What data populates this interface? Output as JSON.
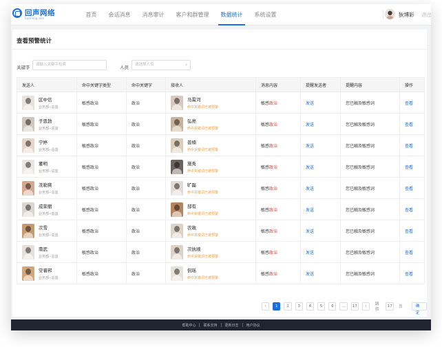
{
  "header": {
    "logo_title": "回声网络",
    "logo_subtitle": "huisheng.com",
    "nav": [
      "首页",
      "会话消息",
      "消息审计",
      "客户和群管理",
      "数据统计",
      "系统设置"
    ],
    "active_nav": 4,
    "user_name": "狄博彩",
    "logout": "退出"
  },
  "page": {
    "title": "查看预警统计",
    "filters": {
      "keyword_label": "关键字",
      "keyword_placeholder": "请输入关键字检索",
      "person_label": "人员",
      "person_placeholder": "请选择人员"
    }
  },
  "table": {
    "columns": [
      "发送人",
      "命中关键字类型",
      "命中关键字",
      "接收人",
      "消息内容",
      "提醒发送者",
      "提醒内容",
      "操作"
    ],
    "rows": [
      {
        "sender": "区中信",
        "sender_dept": "业务部--总监",
        "type": "敏感政治",
        "keyword": "政治",
        "receiver": "马霄河",
        "receiver_note": "命中关键词已被预警",
        "msg_a": "敏感",
        "msg_b": "政治",
        "notify": "发送",
        "remind": "您已触及敏感词",
        "action": "查看",
        "c1": "#e8e2da",
        "c2": "#d8c9bf"
      },
      {
        "sender": "于恩勃",
        "sender_dept": "业务部--总监",
        "type": "敏感政治",
        "keyword": "政治",
        "receiver": "弘亮",
        "receiver_note": "命中关键词已被预警",
        "msg_a": "敏感",
        "msg_b": "政治",
        "notify": "发送",
        "remind": "您已触及敏感词",
        "action": "查看",
        "c1": "#cfc6bd",
        "c2": "#c9b19c"
      },
      {
        "sender": "宁婷",
        "sender_dept": "业务部--总监",
        "type": "敏感政治",
        "keyword": "政治",
        "receiver": "普楠",
        "receiver_note": "命中关键词已被预警",
        "msg_a": "敏感",
        "msg_b": "政治",
        "notify": "发送",
        "remind": "您已触及敏感词",
        "action": "查看",
        "c1": "#e8d5c7",
        "c2": "#dccdb9"
      },
      {
        "sender": "董明",
        "sender_dept": "业务部--总监",
        "type": "敏感政治",
        "keyword": "政治",
        "receiver": "施秀",
        "receiver_note": "命中关键词已被预警",
        "msg_a": "敏感",
        "msg_b": "政治",
        "notify": "发送",
        "remind": "您已触及敏感词",
        "action": "查看",
        "c1": "#ece4de",
        "c2": "#6b6460"
      },
      {
        "sender": "冼勒爽",
        "sender_dept": "业务部--总监",
        "type": "敏感政治",
        "keyword": "政治",
        "receiver": "旷磊",
        "receiver_note": "命中关键词已被预警",
        "msg_a": "敏感",
        "msg_b": "政治",
        "notify": "发送",
        "remind": "您已触及敏感词",
        "action": "查看",
        "c1": "#d6a98e",
        "c2": "#e2dad6"
      },
      {
        "sender": "成荣丽",
        "sender_dept": "业务部--总监",
        "type": "敏感政治",
        "keyword": "政治",
        "receiver": "部有",
        "receiver_note": "命中关键词已被预警",
        "msg_a": "敏感",
        "msg_b": "政治",
        "notify": "发送",
        "remind": "您已触及敏感词",
        "action": "查看",
        "c1": "#ddd6cf",
        "c2": "#b4845e"
      },
      {
        "sender": "次雪",
        "sender_dept": "业务部--总监",
        "type": "敏感政治",
        "keyword": "政治",
        "receiver": "农政",
        "receiver_note": "命中关键词已被预警",
        "msg_a": "敏感",
        "msg_b": "政治",
        "notify": "发送",
        "remind": "您已触及敏感词",
        "action": "查看",
        "c1": "#c79b6e",
        "c2": "#dcd2c8"
      },
      {
        "sender": "南武",
        "sender_dept": "业务部--总监",
        "type": "敏感政治",
        "keyword": "政治",
        "receiver": "次执顺",
        "receiver_note": "命中关键词已被预警",
        "msg_a": "敏感",
        "msg_b": "政治",
        "notify": "发送",
        "remind": "您已触及敏感词",
        "action": "查看",
        "c1": "#e5dfd9",
        "c2": "#ddd2c8"
      },
      {
        "sender": "空睿邦",
        "sender_dept": "业务部--总监",
        "type": "敏感政治",
        "keyword": "政治",
        "receiver": "侃瑶",
        "receiver_note": "命中关键词已被预警",
        "msg_a": "敏感",
        "msg_b": "政治",
        "notify": "发送",
        "remind": "您已触及敏感词",
        "action": "查看",
        "c1": "#d3a77c",
        "c2": "#e7e1dc"
      }
    ]
  },
  "pagination": {
    "prev": "‹",
    "pages": [
      "1",
      "2",
      "3",
      "4",
      "5",
      "6",
      "...",
      "17"
    ],
    "active_page": 0,
    "next": "›",
    "jump_label": "跳转",
    "jump_value": "17",
    "page_unit": "页",
    "confirm": "确定"
  },
  "footer": {
    "links": [
      "帮助中心",
      "联系支持",
      "更新日志",
      "用户协议"
    ]
  }
}
